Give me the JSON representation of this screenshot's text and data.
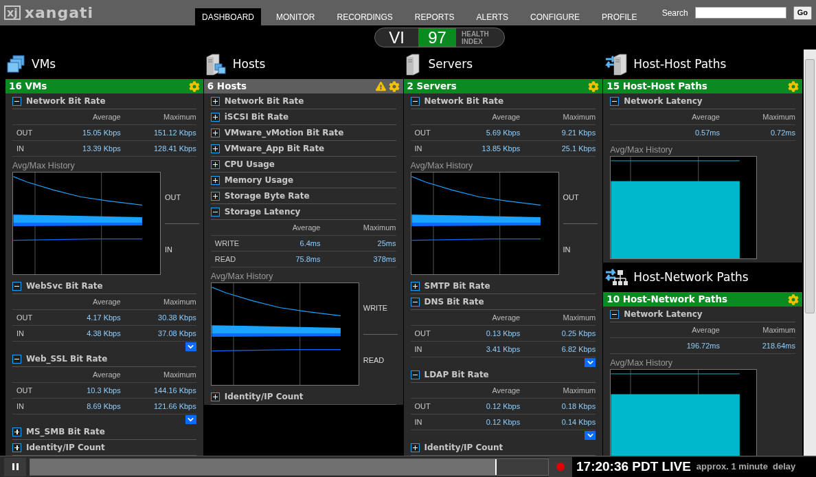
{
  "brand": {
    "mark": "xj",
    "name": "xangati"
  },
  "nav": [
    {
      "label": "DASHBOARD",
      "selected": true
    },
    {
      "label": "MONITOR",
      "selected": false
    },
    {
      "label": "RECORDINGS",
      "selected": false
    },
    {
      "label": "REPORTS",
      "selected": false
    },
    {
      "label": "ALERTS",
      "selected": false
    },
    {
      "label": "CONFIGURE",
      "selected": false
    },
    {
      "label": "PROFILE",
      "selected": false
    }
  ],
  "search": {
    "label": "Search",
    "button": "Go"
  },
  "health": {
    "prefix": "VI",
    "score": "97",
    "label": "HEALTH INDEX"
  },
  "columns": [
    {
      "groups": [
        {
          "title": "VMs",
          "panel": {
            "title": "16 VMs",
            "alert": false,
            "sections": [
              {
                "title": "Network Bit Rate",
                "expanded": true,
                "headers": [
                  "Average",
                  "Maximum"
                ],
                "rows": [
                  {
                    "label": "OUT",
                    "average": "15.05 Kbps",
                    "maximum": "151.12 Kbps"
                  },
                  {
                    "label": "IN",
                    "average": "13.39 Kbps",
                    "maximum": "128.41 Kbps"
                  }
                ],
                "history": {
                  "title": "Avg/Max History",
                  "kind": "split",
                  "labels": [
                    "OUT",
                    "IN"
                  ]
                }
              },
              {
                "title": "WebSvc Bit Rate",
                "expanded": true,
                "headers": [
                  "Average",
                  "Maximum"
                ],
                "rows": [
                  {
                    "label": "OUT",
                    "average": "4.17 Kbps",
                    "maximum": "30.38 Kbps"
                  },
                  {
                    "label": "IN",
                    "average": "4.38 Kbps",
                    "maximum": "37.08 Kbps"
                  }
                ],
                "more": true
              },
              {
                "title": "Web_SSL Bit Rate",
                "expanded": true,
                "headers": [
                  "Average",
                  "Maximum"
                ],
                "rows": [
                  {
                    "label": "OUT",
                    "average": "10.3 Kbps",
                    "maximum": "144.16 Kbps"
                  },
                  {
                    "label": "IN",
                    "average": "8.69 Kbps",
                    "maximum": "121.66 Kbps"
                  }
                ],
                "more": true
              },
              {
                "title": "MS_SMB Bit Rate",
                "expanded": false
              },
              {
                "title": "Identity/IP Count",
                "expanded": false
              }
            ]
          }
        }
      ]
    },
    {
      "groups": [
        {
          "title": "Hosts",
          "panel": {
            "title": "6 Hosts",
            "alert": true,
            "sections": [
              {
                "title": "Network Bit Rate",
                "expanded": false
              },
              {
                "title": "iSCSI Bit Rate",
                "expanded": false
              },
              {
                "title": "VMware_vMotion Bit Rate",
                "expanded": false
              },
              {
                "title": "VMware_App Bit Rate",
                "expanded": false
              },
              {
                "title": "CPU Usage",
                "expanded": false
              },
              {
                "title": "Memory Usage",
                "expanded": false
              },
              {
                "title": "Storage Byte Rate",
                "expanded": false
              },
              {
                "title": "Storage Latency",
                "expanded": true,
                "headers": [
                  "Average",
                  "Maximum"
                ],
                "rows": [
                  {
                    "label": "WRITE",
                    "average": "6.4ms",
                    "maximum": "25ms"
                  },
                  {
                    "label": "READ",
                    "average": "75.8ms",
                    "maximum": "378ms"
                  }
                ],
                "history": {
                  "title": "Avg/Max History",
                  "kind": "split",
                  "labels": [
                    "WRITE",
                    "READ"
                  ]
                }
              },
              {
                "title": "Identity/IP Count",
                "expanded": false
              }
            ]
          }
        }
      ]
    },
    {
      "groups": [
        {
          "title": "Servers",
          "panel": {
            "title": "2 Servers",
            "alert": false,
            "sections": [
              {
                "title": "Network Bit Rate",
                "expanded": true,
                "headers": [
                  "Average",
                  "Maximum"
                ],
                "rows": [
                  {
                    "label": "OUT",
                    "average": "5.69 Kbps",
                    "maximum": "9.21 Kbps"
                  },
                  {
                    "label": "IN",
                    "average": "13.85 Kbps",
                    "maximum": "25.1 Kbps"
                  }
                ],
                "history": {
                  "title": "Avg/Max History",
                  "kind": "split",
                  "labels": [
                    "OUT",
                    "IN"
                  ]
                }
              },
              {
                "title": "SMTP Bit Rate",
                "expanded": false
              },
              {
                "title": "DNS Bit Rate",
                "expanded": true,
                "headers": [
                  "Average",
                  "Maximum"
                ],
                "rows": [
                  {
                    "label": "OUT",
                    "average": "0.13 Kbps",
                    "maximum": "0.25 Kbps"
                  },
                  {
                    "label": "IN",
                    "average": "3.41 Kbps",
                    "maximum": "6.82 Kbps"
                  }
                ],
                "more": true
              },
              {
                "title": "LDAP Bit Rate",
                "expanded": true,
                "headers": [
                  "Average",
                  "Maximum"
                ],
                "rows": [
                  {
                    "label": "OUT",
                    "average": "0.12 Kbps",
                    "maximum": "0.18 Kbps"
                  },
                  {
                    "label": "IN",
                    "average": "0.12 Kbps",
                    "maximum": "0.14 Kbps"
                  }
                ],
                "more": true
              },
              {
                "title": "Identity/IP Count",
                "expanded": false
              }
            ]
          }
        }
      ]
    },
    {
      "groups": [
        {
          "title": "Host-Host Paths",
          "panel": {
            "title": "15 Host-Host Paths",
            "alert": false,
            "sections": [
              {
                "title": "Network Latency",
                "expanded": true,
                "headers": [
                  "Average",
                  "Maximum"
                ],
                "rows": [
                  {
                    "average": "0.57ms",
                    "maximum": "0.72ms"
                  }
                ],
                "history": {
                  "title": "Avg/Max History",
                  "kind": "level"
                }
              }
            ]
          }
        },
        {
          "title": "Host-Network Paths",
          "panel": {
            "title": "10 Host-Network Paths",
            "alert": false,
            "sections": [
              {
                "title": "Network Latency",
                "expanded": true,
                "headers": [
                  "Average",
                  "Maximum"
                ],
                "rows": [
                  {
                    "average": "196.72ms",
                    "maximum": "218.64ms"
                  }
                ],
                "history": {
                  "title": "Avg/Max History",
                  "kind": "level"
                }
              }
            ]
          }
        }
      ]
    }
  ],
  "timeline": {
    "level": 0.9
  },
  "clock": {
    "time": "17:20:36 PDT LIVE",
    "delay": "approx. 1 minute  delay"
  }
}
